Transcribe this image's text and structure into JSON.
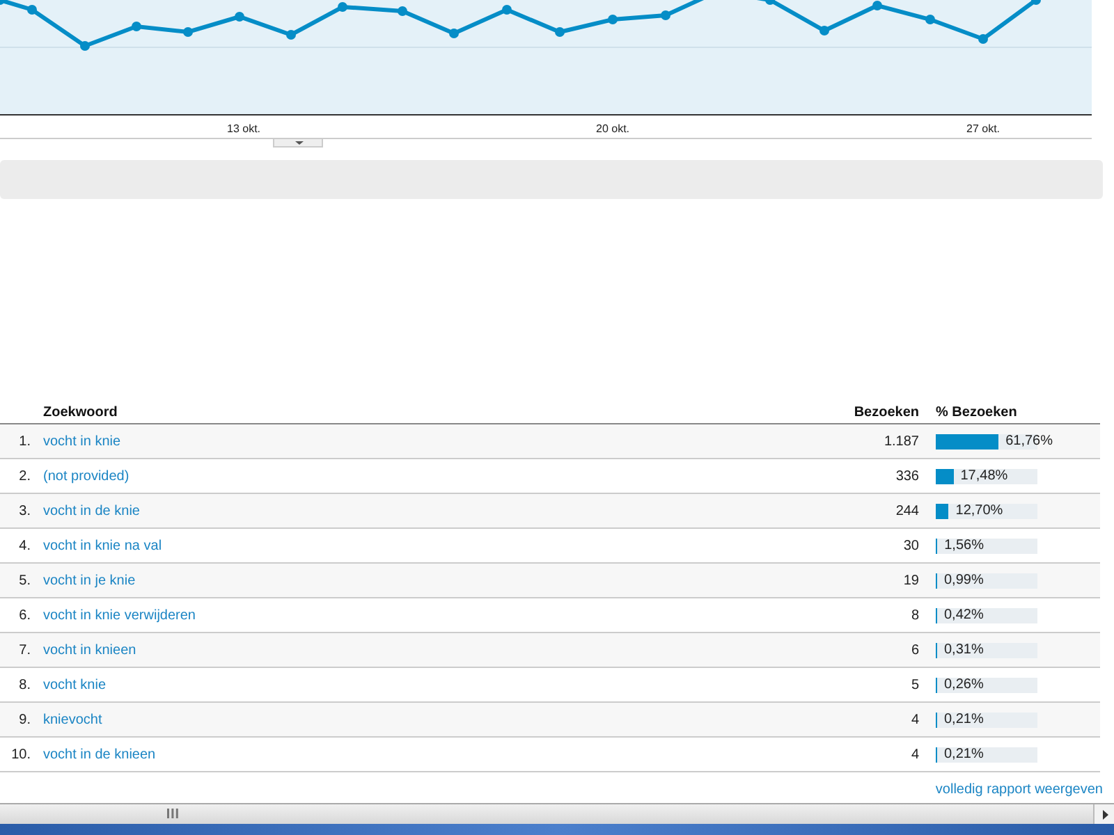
{
  "chart": {
    "x_labels": [
      "13 okt.",
      "20 okt.",
      "27 okt."
    ]
  },
  "table": {
    "columns": [
      "Zoekwoord",
      "Bezoeken",
      "% Bezoeken"
    ],
    "rows": [
      {
        "rank": "1.",
        "keyword": "vocht in knie",
        "visits": "1.187",
        "level": 0.6176,
        "percent": "61,76%"
      },
      {
        "rank": "2.",
        "keyword": "(not provided)",
        "visits": "336",
        "level": 0.1748,
        "percent": "17,48%"
      },
      {
        "rank": "3.",
        "keyword": "vocht in de knie",
        "visits": "244",
        "level": 0.127,
        "percent": "12,70%"
      },
      {
        "rank": "4.",
        "keyword": "vocht in knie na val",
        "visits": "30",
        "level": 0.0156,
        "percent": "1,56%"
      },
      {
        "rank": "5.",
        "keyword": "vocht in je knie",
        "visits": "19",
        "level": 0.0099,
        "percent": "0,99%"
      },
      {
        "rank": "6.",
        "keyword": "vocht in knie verwijderen",
        "visits": "8",
        "level": 0.0042,
        "percent": "0,42%"
      },
      {
        "rank": "7.",
        "keyword": "vocht in knieen",
        "visits": "6",
        "level": 0.0031,
        "percent": "0,31%"
      },
      {
        "rank": "8.",
        "keyword": "vocht knie",
        "visits": "5",
        "level": 0.0026,
        "percent": "0,26%"
      },
      {
        "rank": "9.",
        "keyword": "knievocht",
        "visits": "4",
        "level": 0.0021,
        "percent": "0,21%"
      },
      {
        "rank": "10.",
        "keyword": "vocht in de knieen",
        "visits": "4",
        "level": 0.0021,
        "percent": "0,21%"
      }
    ]
  },
  "footer_link": "volledig rapport weergeven"
}
